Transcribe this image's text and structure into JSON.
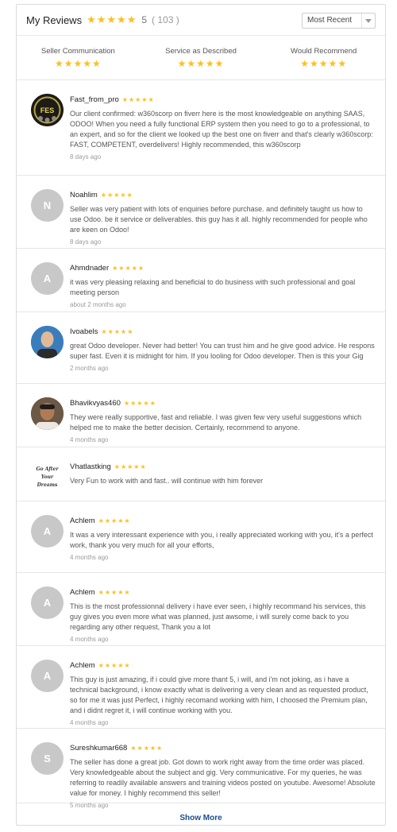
{
  "header": {
    "title": "My Reviews",
    "stars": "★★★★★",
    "score": "5",
    "count": "( 103 )",
    "sort_selected": "Most Recent"
  },
  "breakdown": [
    {
      "label": "Seller Communication",
      "stars": "★★★★★"
    },
    {
      "label": "Service as Described",
      "stars": "★★★★★"
    },
    {
      "label": "Would Recommend",
      "stars": "★★★★★"
    }
  ],
  "reviews": [
    {
      "user": "Fast_from_pro",
      "stars": "★★★★★",
      "avatar": "",
      "text": "Our client confirmed: w360scorp on fiverr here is the most knowledgeable on anything SAAS, ODOO! When you need a fully functional ERP system then you need to go to a professional, to an expert, and so for the client we looked up the best one on fiverr and that's clearly w360scorp: FAST, COMPETENT, overdelivers! Highly recommended, this w360scorp",
      "ago": "8 days ago"
    },
    {
      "user": "Noahlim",
      "stars": "★★★★★",
      "avatar": "N",
      "text": "Seller was very patient with lots of enquiries before purchase. and definitely taught us how to use Odoo. be it service or deliverables. this guy has it all. highly recommended for people who are keen on Odoo!",
      "ago": "8 days ago"
    },
    {
      "user": "Ahmdnader",
      "stars": "★★★★★",
      "avatar": "A",
      "text": "it was very pleasing relaxing and beneficial to do business with such professional and goal meeting person",
      "ago": "about 2 months ago"
    },
    {
      "user": "Ivoabels",
      "stars": "★★★★★",
      "avatar": "",
      "text": "great Odoo developer. Never had better! You can trust him and he give good advice. He respons super fast. Even it is midnight for him. If you looling for Odoo developer. Then is this your Gig",
      "ago": "2 months ago"
    },
    {
      "user": "Bhavikvyas460",
      "stars": "★★★★★",
      "avatar": "",
      "text": "They were really supportive, fast and reliable. I was given few very useful suggestions which helped me to make the better decision. Certainly, recommend to anyone.",
      "ago": "4 months ago"
    },
    {
      "user": "Vhatlastking",
      "stars": "★★★★★",
      "avatar": "",
      "text": "Very Fun to work with and fast.. will continue with him forever",
      "ago": ""
    },
    {
      "user": "Achlem",
      "stars": "★★★★★",
      "avatar": "A",
      "text": "It was a very interessant experience with you, i really appreciated working with you, it's a perfect work, thank you very much for all your efforts,",
      "ago": "4 months ago"
    },
    {
      "user": "Achlem",
      "stars": "★★★★★",
      "avatar": "A",
      "text": "This is the most professionnal delivery i have ever seen, i highly recommand his services, this guy gives you even more what was planned, just awsome, i will surely come back to you regarding any other request, Thank you a lot",
      "ago": "4 months ago"
    },
    {
      "user": "Achlem",
      "stars": "★★★★★",
      "avatar": "A",
      "text": "This guy is just amazing, if i could give more thant 5, i will, and i'm not joking, as i have a technical background, i know exactly what is delivering a very clean and as requested product, so for me it was just Perfect, i highly recomand working with him, I choosed the Premium plan, and i didnt regret it, i will continue working with you.",
      "ago": "4 months ago"
    },
    {
      "user": "Sureshkumar668",
      "stars": "★★★★★",
      "avatar": "S",
      "text": "The seller has done a great job. Got down to work right away from the time order was placed. Very knowledgeable about the subject and gig. Very communicative. For my queries, he was referring to readily available answers and training videos posted on youtube. Awesome! Absolute value for money. I highly recommend this seller!",
      "ago": "5 months ago"
    }
  ],
  "show_more": "Show More",
  "logo_text": {
    "fes": "FES",
    "vhat": "Go After Your Dreams"
  }
}
